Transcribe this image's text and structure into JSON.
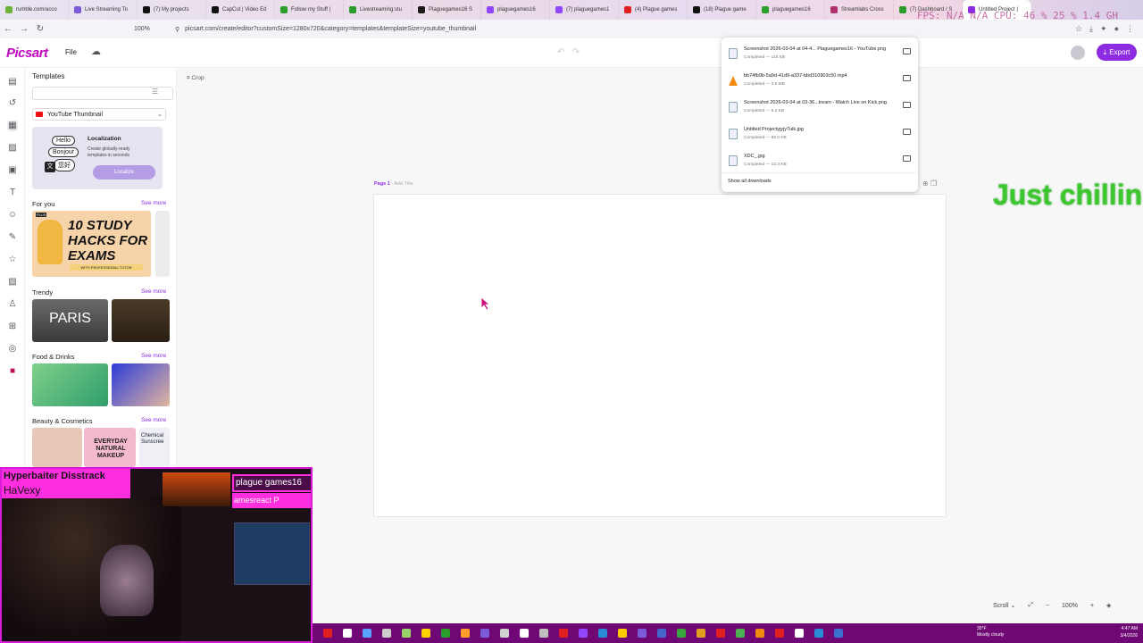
{
  "browser": {
    "tabs": [
      {
        "label": "rumble.com/acco",
        "color": "#6bb33b"
      },
      {
        "label": "Live Streaming To",
        "color": "#7b5cd6"
      },
      {
        "label": "(7) My projects",
        "color": "#111111"
      },
      {
        "label": "CapCut | Video Ed",
        "color": "#111111"
      },
      {
        "label": "Follow my Stuff |",
        "color": "#2a9d2a"
      },
      {
        "label": "Livestreaming:stu",
        "color": "#2a9d2a"
      },
      {
        "label": "Plaguegames16 S",
        "color": "#1a1a1a"
      },
      {
        "label": "plaguegames16",
        "color": "#9146ff"
      },
      {
        "label": "(7) plaguegames1",
        "color": "#9146ff"
      },
      {
        "label": "(4) Plague games",
        "color": "#e02020"
      },
      {
        "label": "(18) Plague game",
        "color": "#111111"
      },
      {
        "label": "plaguegames16",
        "color": "#2a9d2a"
      },
      {
        "label": "Streamlabs Cross",
        "color": "#b0306d"
      },
      {
        "label": "(7) Dashboard / S",
        "color": "#2a9d2a"
      },
      {
        "label": "Untitled Project |",
        "color": "#8c2be2"
      }
    ],
    "fps_overlay": "FPS: N/A  N/A   CPU: 46 %   25 %  1.4 GH",
    "zoom": "100%",
    "url": "picsart.com/create/editor?customSize=1280x720&category=templates&templateSize=youtube_thumbnail"
  },
  "app": {
    "logo": "Picsart",
    "file_menu": "File",
    "export_label": "Export",
    "crop_label": "Crop"
  },
  "panel": {
    "title": "Templates",
    "search_placeholder": "",
    "category": "YouTube Thumbnail",
    "promo": {
      "bubbles": [
        "Hello",
        "Bonjour",
        "您好"
      ],
      "title": "Localization",
      "desc": "Create globally-ready templates in seconds",
      "button": "Localize"
    },
    "sections": [
      {
        "title": "For you",
        "see": "See more",
        "thumb_text": "10 STUDY HACKS FOR EXAMS",
        "thumb_sub": "WITH PROFESSIONAL TUTOR"
      },
      {
        "title": "Trendy",
        "see": "See more",
        "thumb_text": "PARIS"
      },
      {
        "title": "Food & Drinks",
        "see": "See more"
      },
      {
        "title": "Beauty & Cosmetics",
        "see": "See more",
        "thumb_text": "EVERYDAY NATURAL MAKEUP",
        "thumb_text2": "Chemical Sunscree"
      }
    ],
    "plus_badge": "PLUS"
  },
  "canvas": {
    "page_label": "Page 1",
    "add_title": " - Add Title"
  },
  "overlay_text": "Just chillin",
  "downloads": {
    "items": [
      {
        "name": "Screenshot 2026-03-04 at 04-4... Plaguegames16 - YouTube.png",
        "status": "Completed — 118 KB",
        "icon": "image-file-icon"
      },
      {
        "name": "bb74fb9b-5a9d-41d9-a337-bbd310903c50.mp4",
        "status": "Completed — 3.6 MB",
        "icon": "vlc-file-icon"
      },
      {
        "name": "Screenshot 2026-03-04 at 03-36...tream - Watch Live on Kick.png",
        "status": "Completed — 5.4 KB",
        "icon": "image-file-icon"
      },
      {
        "name": "Untitled Projectyjyjy7uik.jpg",
        "status": "Completed — 98.0 KB",
        "icon": "image-file-icon"
      },
      {
        "name": "XDC_.jpg",
        "status": "Completed — 22.3 KB",
        "icon": "image-file-icon"
      }
    ],
    "show_all": "Show all downloads"
  },
  "bottom_controls": {
    "scroll": "Scroll",
    "zoom": "100%"
  },
  "taskbar": {
    "weather_temp": "35°F",
    "weather_desc": "Mostly cloudy",
    "time": "4:47 AM",
    "date": "3/4/2026"
  },
  "webcam": {
    "song_title": "Hyperbaiter Disstrack",
    "song_artist": "HaVexy",
    "name_tag": "plague games16",
    "name_tag2": "amesreact P"
  }
}
